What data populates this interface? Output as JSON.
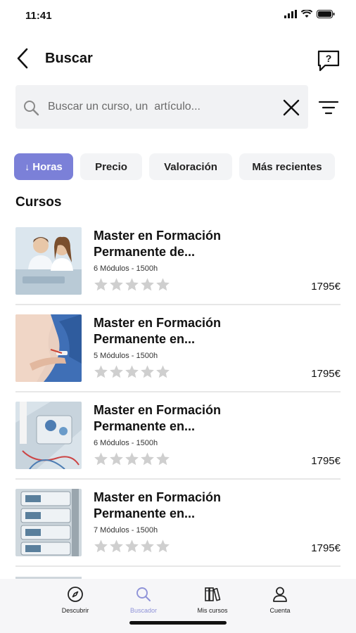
{
  "status_bar": {
    "time": "11:41"
  },
  "header": {
    "title": "Buscar",
    "back_icon": "chevron-left-icon",
    "help_icon": "help-chat-icon"
  },
  "search": {
    "placeholder": "Buscar un curso, un  artículo...",
    "value": ""
  },
  "chips": [
    {
      "label": "Horas",
      "active": true,
      "icon": "arrow-down-icon"
    },
    {
      "label": "Precio",
      "active": false
    },
    {
      "label": "Valoración",
      "active": false
    },
    {
      "label": "Más recientes",
      "active": false
    }
  ],
  "section_title": "Cursos",
  "courses": [
    {
      "title_line1": "Master en Formación",
      "title_line2": "Permanente de...",
      "meta": "6 Módulos - 1500h",
      "rating": 0,
      "price": "1795€",
      "image": "doctors-portrait"
    },
    {
      "title_line1": "Master en Formación",
      "title_line2": "Permanente en...",
      "meta": "5 Módulos - 1500h",
      "rating": 0,
      "price": "1795€",
      "image": "patient-hand"
    },
    {
      "title_line1": "Master en Formación",
      "title_line2": "Permanente en...",
      "meta": "6 Módulos - 1500h",
      "rating": 0,
      "price": "1795€",
      "image": "medical-equipment"
    },
    {
      "title_line1": "Master en Formación",
      "title_line2": "Permanente en...",
      "meta": "7 Módulos - 1500h",
      "rating": 0,
      "price": "1795€",
      "image": "infusion-pumps"
    }
  ],
  "tabbar": [
    {
      "label": "Descubrir",
      "icon": "compass-icon",
      "active": false
    },
    {
      "label": "Buscador",
      "icon": "search-icon",
      "active": true
    },
    {
      "label": "Mis cursos",
      "icon": "books-icon",
      "active": false
    },
    {
      "label": "Cuenta",
      "icon": "user-icon",
      "active": false
    }
  ],
  "colors": {
    "accent": "#7b80d8",
    "star": "#cfcfcf",
    "tab_active": "#8f93d8"
  }
}
